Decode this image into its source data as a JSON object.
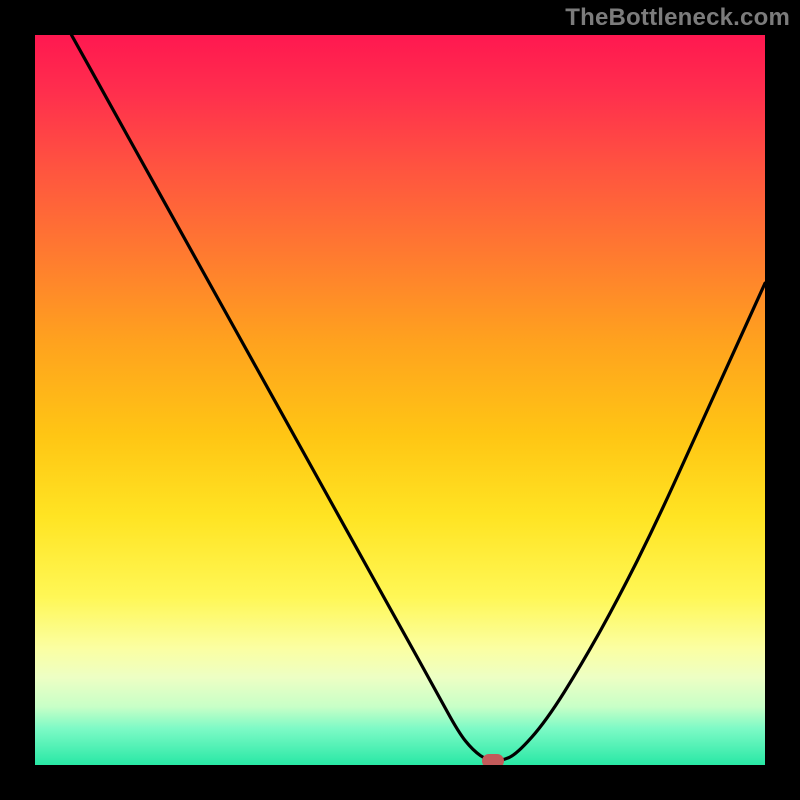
{
  "watermark": "TheBottleneck.com",
  "plot": {
    "inner_left": 35,
    "inner_top": 35,
    "inner_width": 730,
    "inner_height": 730
  },
  "marker": {
    "x_frac": 0.628,
    "y_frac": 0.994,
    "color": "#c35a5a"
  },
  "chart_data": {
    "type": "line",
    "title": "",
    "xlabel": "",
    "ylabel": "",
    "xlim": [
      0,
      100
    ],
    "ylim": [
      0,
      100
    ],
    "grid": false,
    "legend": false,
    "series": [
      {
        "name": "curve",
        "x": [
          5,
          10,
          15,
          20,
          25,
          30,
          35,
          40,
          45,
          50,
          55,
          58,
          60,
          62,
          64,
          66,
          70,
          75,
          80,
          85,
          90,
          95,
          100
        ],
        "y": [
          100,
          91,
          82,
          73,
          64,
          55,
          46,
          37,
          28,
          19,
          10,
          4.5,
          2,
          0.6,
          0.6,
          1.5,
          6,
          14,
          23,
          33,
          44,
          55,
          66
        ]
      }
    ],
    "optimum_point": {
      "x": 63,
      "y": 0.6
    }
  }
}
